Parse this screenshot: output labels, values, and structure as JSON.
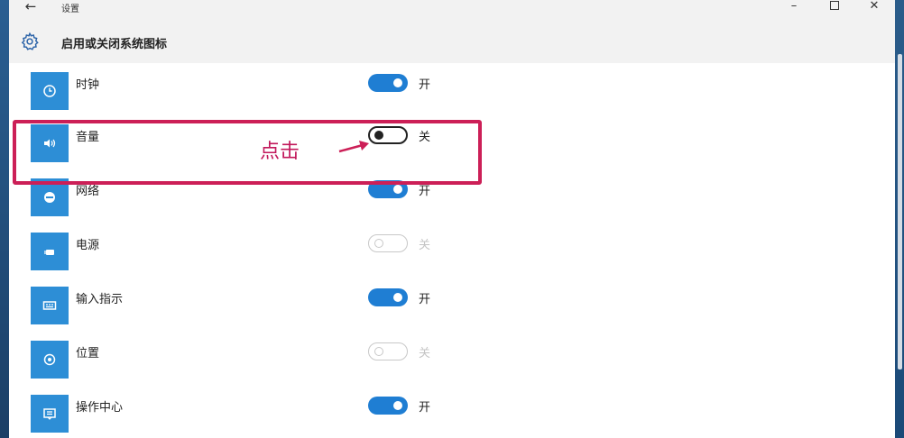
{
  "window": {
    "title": "设置",
    "back_icon": "back-arrow-icon",
    "controls": [
      "minimize-icon",
      "maximize-icon",
      "close-icon"
    ]
  },
  "header": {
    "icon": "gear-icon",
    "title": "启用或关闭系统图标"
  },
  "items": [
    {
      "label": "时钟",
      "icon": "clock-icon",
      "state": "on",
      "state_label": "开"
    },
    {
      "label": "音量",
      "icon": "volume-icon",
      "state": "off",
      "state_label": "关"
    },
    {
      "label": "网络",
      "icon": "network-icon",
      "state": "on",
      "state_label": "开"
    },
    {
      "label": "电源",
      "icon": "power-icon",
      "state": "disabled",
      "state_label": "关"
    },
    {
      "label": "输入指示",
      "icon": "input-indicator-icon",
      "state": "on",
      "state_label": "开"
    },
    {
      "label": "位置",
      "icon": "location-icon",
      "state": "disabled",
      "state_label": "关"
    },
    {
      "label": "操作中心",
      "icon": "action-center-icon",
      "state": "on",
      "state_label": "开"
    }
  ],
  "annotation": {
    "text": "点击",
    "color": "#c2185b",
    "highlight_color": "#cc1f57"
  },
  "colors": {
    "accent": "#2d8ed6",
    "toggle_on": "#1f7ed3",
    "header_bg": "#f2f2f2"
  }
}
